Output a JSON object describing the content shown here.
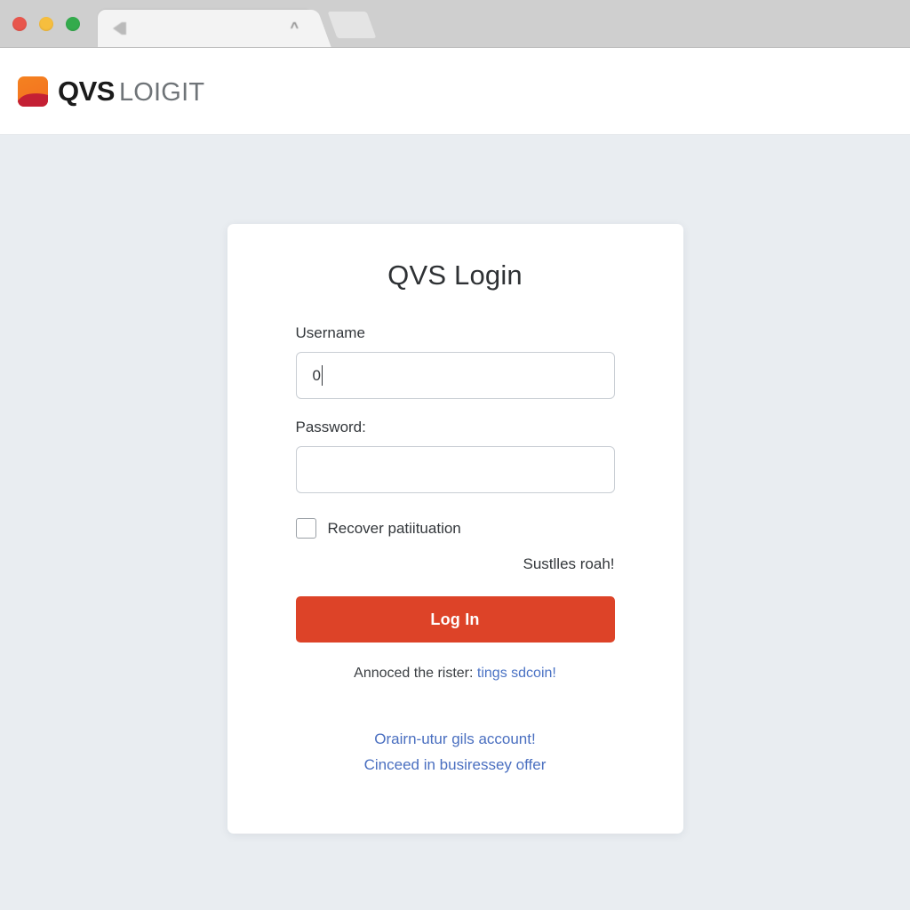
{
  "browser": {
    "traffic_lights": [
      {
        "name": "close",
        "color": "#e8564c"
      },
      {
        "name": "minimize",
        "color": "#f6be3e"
      },
      {
        "name": "maximize",
        "color": "#33ab4c"
      }
    ],
    "tab": {
      "title": "",
      "favicon": "blurred-glyph-icon",
      "action_glyph": "^"
    }
  },
  "header": {
    "logo_icon": "qvs-square-logo-icon",
    "brand_bold": "QVS",
    "brand_light": "LOIGIT"
  },
  "card": {
    "title": "QVS Login",
    "username": {
      "label": "Username",
      "value": "0",
      "placeholder": ""
    },
    "password": {
      "label": "Password:",
      "value": "",
      "placeholder": ""
    },
    "checkbox": {
      "label": "Recover patiituation",
      "checked": false
    },
    "note_right": "Sustlles roah!",
    "login_button": "Log In",
    "inline_note_text": "Annoced the rister:",
    "inline_note_link": "tings sdcoin!",
    "links": [
      "Orairn-utur gils account!",
      "Cinceed in busiressey offer"
    ]
  },
  "colors": {
    "accent": "#dd4328",
    "link": "#4a6fc0",
    "page_bg": "#e9edf1",
    "chrome_bg": "#cfcfcf",
    "card_bg": "#ffffff",
    "logo_orange": "#f26f21",
    "logo_red": "#c42034"
  }
}
